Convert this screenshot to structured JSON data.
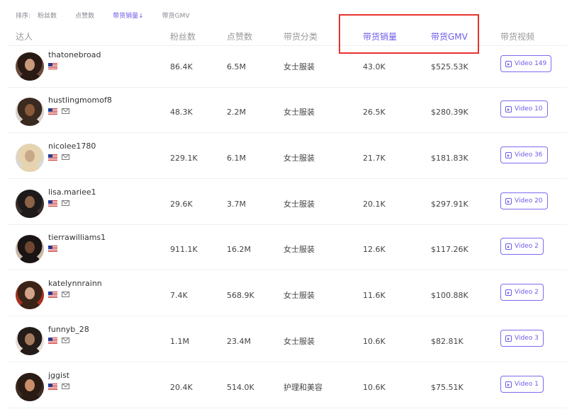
{
  "sortbar": {
    "label": "排序:",
    "options": [
      "粉丝数",
      "点赞数",
      "带货销量↓",
      "带货GMV"
    ],
    "active_color": "#6c5ce7"
  },
  "table": {
    "columns": [
      "达人",
      "粉丝数",
      "点赞数",
      "带货分类",
      "带货销量",
      "带货GMV",
      "带货视频"
    ],
    "highlight_color": "#e8322f",
    "rows": [
      {
        "name": "thatonebroad",
        "followers": "86.4K",
        "likes": "6.5M",
        "category": "女士服装",
        "sales": "43.0K",
        "gmv": "$525.53K",
        "video": "Video 149",
        "has_mail": false
      },
      {
        "name": "hustlingmomof8",
        "followers": "48.3K",
        "likes": "2.2M",
        "category": "女士服装",
        "sales": "26.5K",
        "gmv": "$280.39K",
        "video": "Video 10",
        "has_mail": true
      },
      {
        "name": "nicolee1780",
        "followers": "229.1K",
        "likes": "6.1M",
        "category": "女士服装",
        "sales": "21.7K",
        "gmv": "$181.83K",
        "video": "Video 36",
        "has_mail": true
      },
      {
        "name": "lisa.mariee1",
        "followers": "29.6K",
        "likes": "3.7M",
        "category": "女士服装",
        "sales": "20.1K",
        "gmv": "$297.91K",
        "video": "Video 20",
        "has_mail": true
      },
      {
        "name": "tierrawilliams1",
        "followers": "911.1K",
        "likes": "16.2M",
        "category": "女士服装",
        "sales": "12.6K",
        "gmv": "$117.26K",
        "video": "Video 2",
        "has_mail": false
      },
      {
        "name": "katelynnrainn",
        "followers": "7.4K",
        "likes": "568.9K",
        "category": "女士服装",
        "sales": "11.6K",
        "gmv": "$100.88K",
        "video": "Video 2",
        "has_mail": true
      },
      {
        "name": "funnyb_28",
        "followers": "1.1M",
        "likes": "23.4M",
        "category": "女士服装",
        "sales": "10.6K",
        "gmv": "$82.81K",
        "video": "Video 3",
        "has_mail": true
      },
      {
        "name": "jggist",
        "followers": "20.4K",
        "likes": "514.0K",
        "category": "护理和美容",
        "sales": "10.6K",
        "gmv": "$75.51K",
        "video": "Video 1",
        "has_mail": true
      }
    ]
  }
}
